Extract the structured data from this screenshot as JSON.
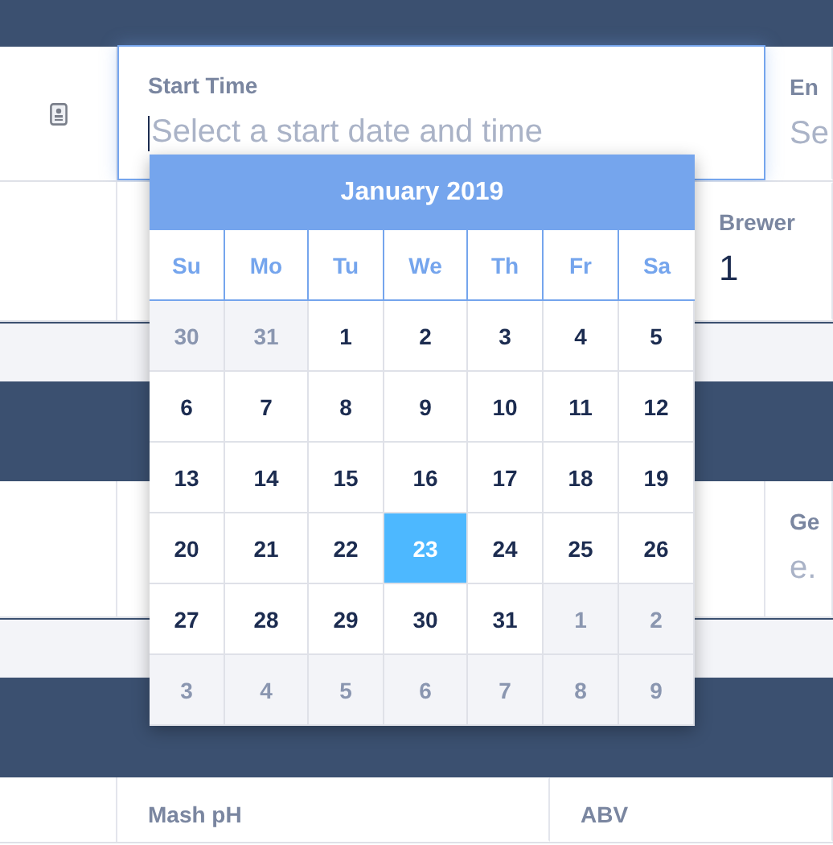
{
  "rows": [
    {
      "kind": "fields",
      "icon": true,
      "fields": [
        {
          "label": "Start Time",
          "placeholder": "Select a start date and time",
          "focused": true
        },
        {
          "label": "En",
          "placeholder": "Se",
          "focused": false
        }
      ]
    },
    {
      "kind": "value",
      "label": "Brewer",
      "value": "1"
    },
    {
      "kind": "fields",
      "fields": [
        {
          "label": "Ge",
          "placeholder": "e.",
          "focused": false
        }
      ]
    },
    {
      "kind": "labels",
      "labels": [
        "Mash pH",
        "ABV"
      ]
    }
  ],
  "calendar": {
    "title": "January 2019",
    "weekdays": [
      "Su",
      "Mo",
      "Tu",
      "We",
      "Th",
      "Fr",
      "Sa"
    ],
    "days": [
      {
        "label": "30",
        "in_month": false,
        "selected": false
      },
      {
        "label": "31",
        "in_month": false,
        "selected": false
      },
      {
        "label": "1",
        "in_month": true,
        "selected": false
      },
      {
        "label": "2",
        "in_month": true,
        "selected": false
      },
      {
        "label": "3",
        "in_month": true,
        "selected": false
      },
      {
        "label": "4",
        "in_month": true,
        "selected": false
      },
      {
        "label": "5",
        "in_month": true,
        "selected": false
      },
      {
        "label": "6",
        "in_month": true,
        "selected": false
      },
      {
        "label": "7",
        "in_month": true,
        "selected": false
      },
      {
        "label": "8",
        "in_month": true,
        "selected": false
      },
      {
        "label": "9",
        "in_month": true,
        "selected": false
      },
      {
        "label": "10",
        "in_month": true,
        "selected": false
      },
      {
        "label": "11",
        "in_month": true,
        "selected": false
      },
      {
        "label": "12",
        "in_month": true,
        "selected": false
      },
      {
        "label": "13",
        "in_month": true,
        "selected": false
      },
      {
        "label": "14",
        "in_month": true,
        "selected": false
      },
      {
        "label": "15",
        "in_month": true,
        "selected": false
      },
      {
        "label": "16",
        "in_month": true,
        "selected": false
      },
      {
        "label": "17",
        "in_month": true,
        "selected": false
      },
      {
        "label": "18",
        "in_month": true,
        "selected": false
      },
      {
        "label": "19",
        "in_month": true,
        "selected": false
      },
      {
        "label": "20",
        "in_month": true,
        "selected": false
      },
      {
        "label": "21",
        "in_month": true,
        "selected": false
      },
      {
        "label": "22",
        "in_month": true,
        "selected": false
      },
      {
        "label": "23",
        "in_month": true,
        "selected": true
      },
      {
        "label": "24",
        "in_month": true,
        "selected": false
      },
      {
        "label": "25",
        "in_month": true,
        "selected": false
      },
      {
        "label": "26",
        "in_month": true,
        "selected": false
      },
      {
        "label": "27",
        "in_month": true,
        "selected": false
      },
      {
        "label": "28",
        "in_month": true,
        "selected": false
      },
      {
        "label": "29",
        "in_month": true,
        "selected": false
      },
      {
        "label": "30",
        "in_month": true,
        "selected": false
      },
      {
        "label": "31",
        "in_month": true,
        "selected": false
      },
      {
        "label": "1",
        "in_month": false,
        "selected": false
      },
      {
        "label": "2",
        "in_month": false,
        "selected": false
      },
      {
        "label": "3",
        "in_month": false,
        "selected": false
      },
      {
        "label": "4",
        "in_month": false,
        "selected": false
      },
      {
        "label": "5",
        "in_month": false,
        "selected": false
      },
      {
        "label": "6",
        "in_month": false,
        "selected": false
      },
      {
        "label": "7",
        "in_month": false,
        "selected": false
      },
      {
        "label": "8",
        "in_month": false,
        "selected": false
      },
      {
        "label": "9",
        "in_month": false,
        "selected": false
      }
    ]
  }
}
